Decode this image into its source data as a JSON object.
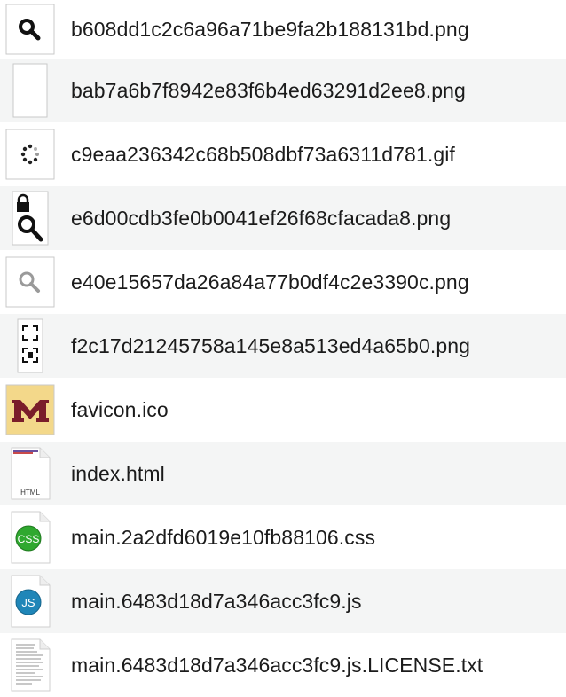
{
  "files": [
    {
      "name": "b608dd1c2c6a96a71be9fa2b188131bd.png",
      "icon": "magnifier-thumbnail-icon"
    },
    {
      "name": "bab7a6b7f8942e83f6b4ed63291d2ee8.png",
      "icon": "blank-thumbnail-icon"
    },
    {
      "name": "c9eaa236342c68b508dbf73a6311d781.gif",
      "icon": "spinner-thumbnail-icon"
    },
    {
      "name": "e6d00cdb3fe0b0041ef26f68cfacada8.png",
      "icon": "lock-magnifier-thumbnail-icon"
    },
    {
      "name": "e40e15657da26a84a77b0df4c2e3390c.png",
      "icon": "light-magnifier-thumbnail-icon"
    },
    {
      "name": "f2c17d21245758a145e8a513ed4a65b0.png",
      "icon": "fullscreen-brackets-thumbnail-icon"
    },
    {
      "name": "favicon.ico",
      "icon": "favicon-m-logo-icon"
    },
    {
      "name": "index.html",
      "icon": "html-document-icon",
      "badge": "HTML"
    },
    {
      "name": "main.2a2dfd6019e10fb88106.css",
      "icon": "css-document-icon",
      "badge": "CSS"
    },
    {
      "name": "main.6483d18d7a346acc3fc9.js",
      "icon": "js-document-icon",
      "badge": "JS"
    },
    {
      "name": "main.6483d18d7a346acc3fc9.js.LICENSE.txt",
      "icon": "text-document-icon"
    }
  ],
  "colors": {
    "css_badge": "#2fa82f",
    "js_badge": "#1f86b8",
    "favicon_bg": "#f3d88a",
    "favicon_mark": "#7a1d2a"
  }
}
